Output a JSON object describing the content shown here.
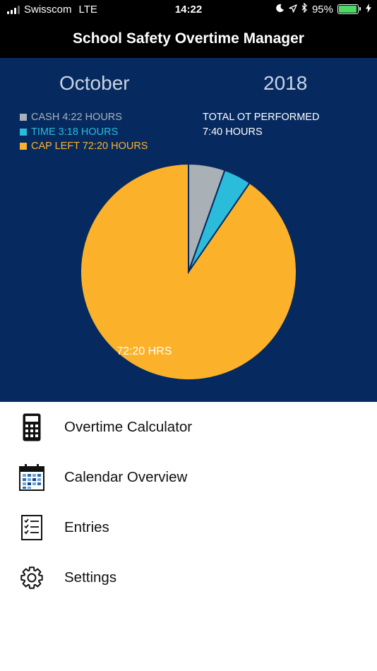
{
  "status_bar": {
    "carrier": "Swisscom",
    "network": "LTE",
    "time": "14:22",
    "battery": "95%",
    "battery_color": "#4cd964"
  },
  "header": {
    "title": "School Safety Overtime Manager"
  },
  "summary": {
    "month": "October",
    "year": "2018",
    "legend": [
      {
        "label": "CASH 4:22 HOURS",
        "color": "#a9b1b6"
      },
      {
        "label": "TIME 3:18 HOURS",
        "color": "#2bbbdb"
      },
      {
        "label": "CAP LEFT 72:20 HOURS",
        "color": "#fbb22a"
      }
    ],
    "total_label": "TOTAL OT PERFORMED",
    "total_value": "7:40 HOURS",
    "panel_color": "#062a5f"
  },
  "chart_data": {
    "type": "pie",
    "slices": [
      {
        "label": "CASH",
        "value": 4.367,
        "color": "#a9b1b6"
      },
      {
        "label": "TIME",
        "value": 3.3,
        "color": "#2bbbdb"
      },
      {
        "label": "CAP LEFT",
        "value": 72.333,
        "color": "#fbb22a"
      }
    ],
    "slice_label": "72:20 HRS"
  },
  "menu": [
    {
      "label": "Overtime Calculator",
      "icon": "calculator-icon"
    },
    {
      "label": "Calendar Overview",
      "icon": "calendar-icon"
    },
    {
      "label": "Entries",
      "icon": "checklist-icon"
    },
    {
      "label": "Settings",
      "icon": "gear-icon"
    }
  ]
}
